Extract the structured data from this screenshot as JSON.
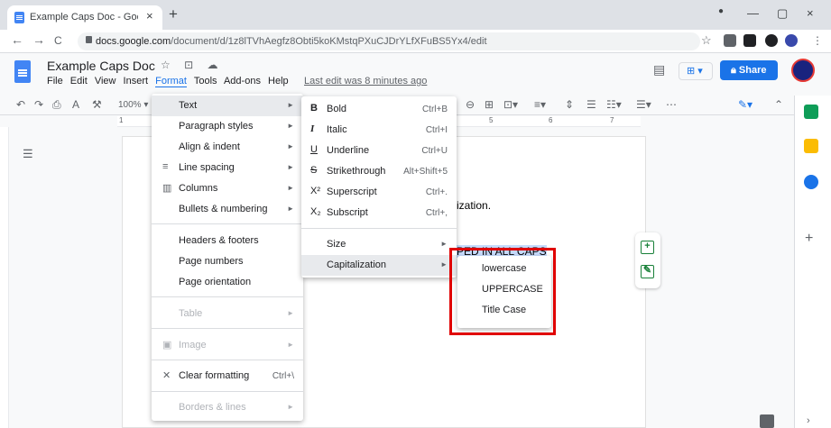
{
  "browser": {
    "tab_title": "Example Caps Doc - Google Doc",
    "close_glyph": "×",
    "newtab_glyph": "+",
    "url_host": "docs.google.com",
    "url_path": "/document/d/1z8lTVhAegfz8Obti5koKMstqPXuCJDrYLfXFuBS5Yx4/edit",
    "nav_back": "←",
    "nav_forward": "→",
    "nav_reload": "C",
    "star": "☆"
  },
  "doc": {
    "title": "Example Caps Doc",
    "title_icons": "☆ ⊡ ☁",
    "menus": [
      "File",
      "Edit",
      "View",
      "Insert",
      "Format",
      "Tools",
      "Add-ons",
      "Help"
    ],
    "last_edit": "Last edit was 8 minutes ago",
    "share_label": "Share",
    "zoom": "100%",
    "text_fragment_1": "ization.",
    "text_fragment_2": "PED IN ALL CAPS"
  },
  "ruler": [
    "1",
    "5",
    "6",
    "7"
  ],
  "format_menu": {
    "items": [
      {
        "label": "Text",
        "arrow": "►",
        "highlighted": true
      },
      {
        "label": "Paragraph styles",
        "arrow": "►"
      },
      {
        "label": "Align & indent",
        "arrow": "►"
      },
      {
        "label": "Line spacing",
        "arrow": "►",
        "icon": "≡"
      },
      {
        "label": "Columns",
        "arrow": "►",
        "icon": "▥"
      },
      {
        "label": "Bullets & numbering",
        "arrow": "►"
      },
      {
        "label": "Headers & footers"
      },
      {
        "label": "Page numbers"
      },
      {
        "label": "Page orientation"
      },
      {
        "label": "Table",
        "arrow": "►",
        "disabled": true
      },
      {
        "label": "Image",
        "arrow": "►",
        "disabled": true,
        "icon": "▣"
      },
      {
        "label": "Clear formatting",
        "shortcut": "Ctrl+\\",
        "icon": "✕"
      },
      {
        "label": "Borders & lines",
        "arrow": "►",
        "disabled": true
      }
    ]
  },
  "text_menu": {
    "items": [
      {
        "icon": "B",
        "label": "Bold",
        "shortcut": "Ctrl+B"
      },
      {
        "icon": "I",
        "label": "Italic",
        "shortcut": "Ctrl+I"
      },
      {
        "icon": "U",
        "label": "Underline",
        "shortcut": "Ctrl+U"
      },
      {
        "icon": "S",
        "label": "Strikethrough",
        "shortcut": "Alt+Shift+5"
      },
      {
        "icon": "X²",
        "label": "Superscript",
        "shortcut": "Ctrl+."
      },
      {
        "icon": "X₂",
        "label": "Subscript",
        "shortcut": "Ctrl+,"
      },
      {
        "label": "Size",
        "arrow": "►"
      },
      {
        "label": "Capitalization",
        "arrow": "►",
        "highlighted": true
      }
    ]
  },
  "caps_menu": {
    "items": [
      "lowercase",
      "UPPERCASE",
      "Title Case"
    ]
  },
  "colors": {
    "accent": "#1a73e8",
    "highlight_box": "#e00000"
  }
}
